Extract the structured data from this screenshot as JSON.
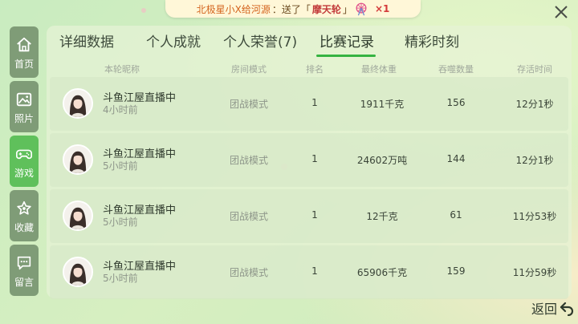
{
  "banner": {
    "sender": "北极星小X给河源",
    "message": "：送了「",
    "gift": "摩天轮",
    "close_quote": "」",
    "count": "×1"
  },
  "sidebar": {
    "items": [
      {
        "label": "首页",
        "icon": "home-icon"
      },
      {
        "label": "照片",
        "icon": "photo-icon"
      },
      {
        "label": "游戏",
        "icon": "gamepad-icon",
        "active": true
      },
      {
        "label": "收藏",
        "icon": "favorite-icon"
      },
      {
        "label": "留言",
        "icon": "message-icon"
      }
    ]
  },
  "tabs": [
    {
      "label": "详细数据"
    },
    {
      "label": "个人成就"
    },
    {
      "label": "个人荣誉(7)"
    },
    {
      "label": "比赛记录",
      "active": true
    },
    {
      "label": "精彩时刻"
    }
  ],
  "table": {
    "headers": [
      "本轮昵称",
      "房间模式",
      "排名",
      "最终体重",
      "吞噬数量",
      "存活时间"
    ],
    "rows": [
      {
        "nickname": "斗鱼江屋直播中",
        "ago": "4小时前",
        "mode": "团战模式",
        "rank": "1",
        "weight": "1911千克",
        "eaten": "156",
        "survival": "12分1秒"
      },
      {
        "nickname": "斗鱼江屋直播中",
        "ago": "5小时前",
        "mode": "团战模式",
        "rank": "1",
        "weight": "24602万吨",
        "eaten": "144",
        "survival": "12分1秒"
      },
      {
        "nickname": "斗鱼江屋直播中",
        "ago": "5小时前",
        "mode": "团战模式",
        "rank": "1",
        "weight": "12千克",
        "eaten": "61",
        "survival": "11分53秒"
      },
      {
        "nickname": "斗鱼江屋直播中",
        "ago": "5小时前",
        "mode": "团战模式",
        "rank": "1",
        "weight": "65906千克",
        "eaten": "159",
        "survival": "11分59秒"
      }
    ]
  },
  "footer": {
    "back_label": "返回"
  },
  "colors": {
    "accent": "#35b341",
    "sidebar_active": "#5fc05b",
    "sidebar": "#7f9c77"
  }
}
